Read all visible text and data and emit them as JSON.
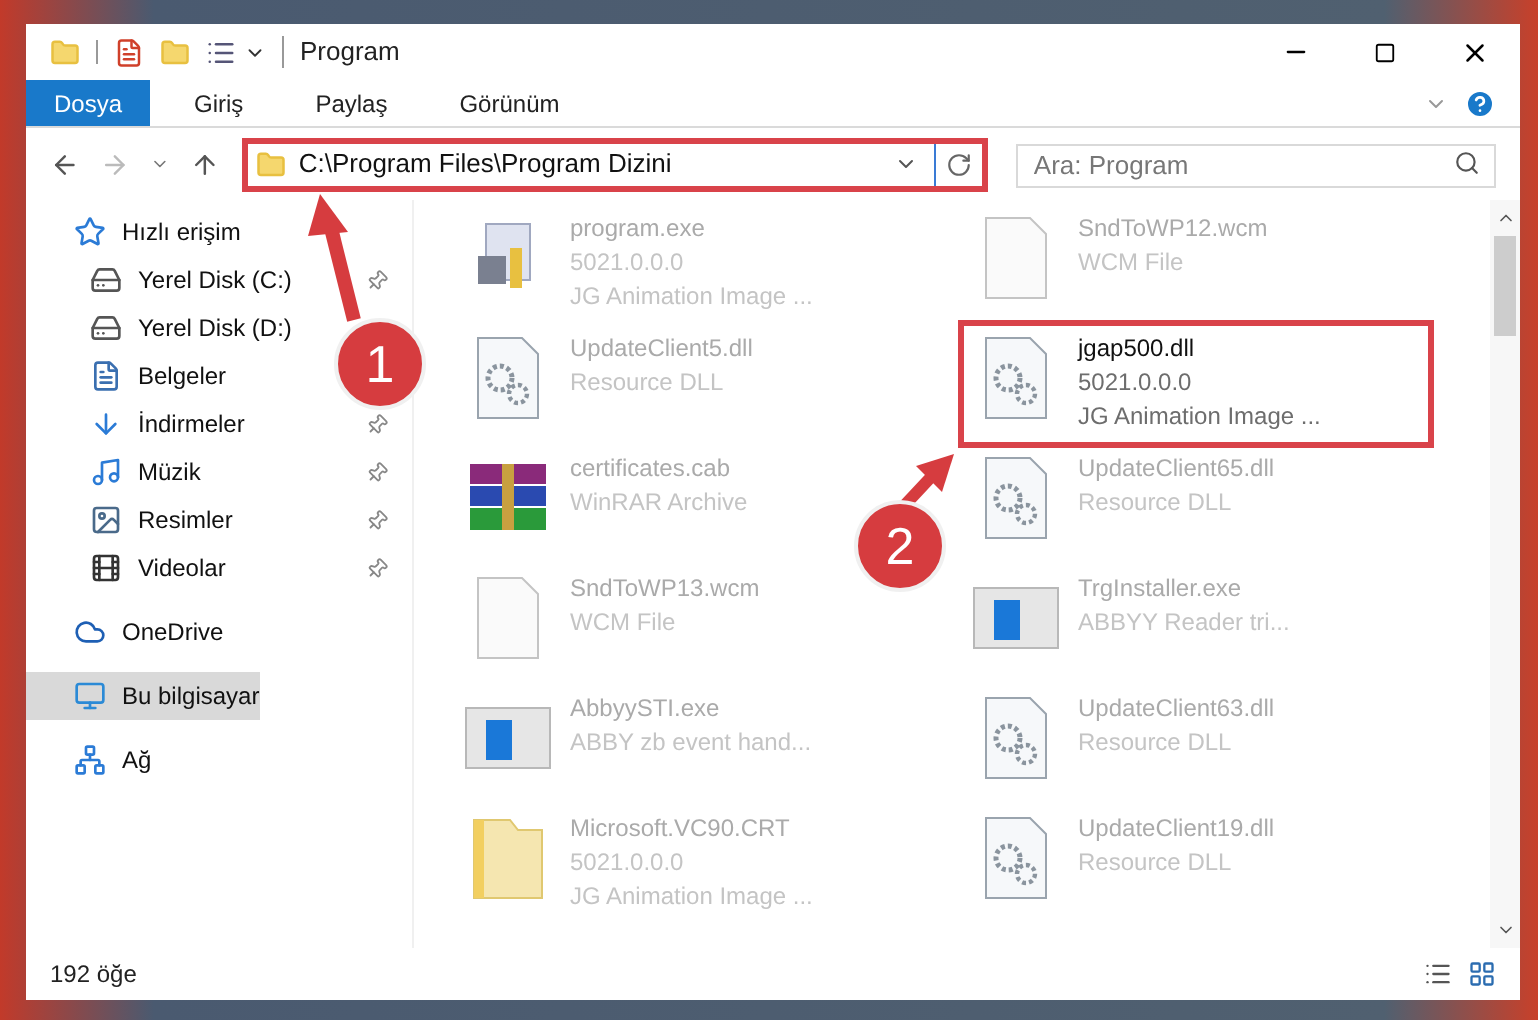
{
  "window": {
    "title": "Program"
  },
  "ribbon_tabs": [
    {
      "label": "Dosya",
      "selected": true
    },
    {
      "label": "Giriş",
      "selected": false
    },
    {
      "label": "Paylaş",
      "selected": false
    },
    {
      "label": "Görünüm",
      "selected": false
    }
  ],
  "address": {
    "path": "C:\\Program Files\\Program Dizini"
  },
  "search": {
    "placeholder": "Ara: Program"
  },
  "sidebar": {
    "items": [
      {
        "label": "Hızlı erişim",
        "kind": "star",
        "selected": false,
        "children": [
          {
            "label": "Yerel Disk (C:)",
            "kind": "drive",
            "pinned": true
          },
          {
            "label": "Yerel Disk (D:)",
            "kind": "drive",
            "pinned": false
          },
          {
            "label": "Belgeler",
            "kind": "document",
            "pinned": false
          },
          {
            "label": "İndirmeler",
            "kind": "download",
            "pinned": true
          },
          {
            "label": "Müzik",
            "kind": "music",
            "pinned": true
          },
          {
            "label": "Resimler",
            "kind": "picture",
            "pinned": true
          },
          {
            "label": "Videolar",
            "kind": "video",
            "pinned": true
          }
        ]
      },
      {
        "label": "OneDrive",
        "kind": "cloud",
        "selected": false
      },
      {
        "label": "Bu bilgisayar",
        "kind": "computer",
        "selected": true
      },
      {
        "label": "Ağ",
        "kind": "network",
        "selected": false
      }
    ]
  },
  "files": [
    {
      "name": "program.exe",
      "details": [
        "5021.0.0.0",
        "JG Animation Image ..."
      ],
      "kind": "exe",
      "highlighted": false
    },
    {
      "name": "SndToWP12.wcm",
      "details": [
        "WCM File"
      ],
      "kind": "blank",
      "highlighted": false
    },
    {
      "name": "UpdateClient5.dll",
      "details": [
        "Resource DLL"
      ],
      "kind": "dll",
      "highlighted": false
    },
    {
      "name": "jgap500.dll",
      "details": [
        "5021.0.0.0",
        "JG Animation Image ..."
      ],
      "kind": "dll",
      "highlighted": true
    },
    {
      "name": "certificates.cab",
      "details": [
        "WinRAR Archive"
      ],
      "kind": "archive",
      "highlighted": false
    },
    {
      "name": "UpdateClient65.dll",
      "details": [
        "Resource DLL"
      ],
      "kind": "dll",
      "highlighted": false
    },
    {
      "name": "SndToWP13.wcm",
      "details": [
        "WCM File"
      ],
      "kind": "blank",
      "highlighted": false
    },
    {
      "name": "TrgInstaller.exe",
      "details": [
        "ABBYY Reader tri..."
      ],
      "kind": "app",
      "highlighted": false
    },
    {
      "name": "AbbyySTI.exe",
      "details": [
        "ABBY zb event hand..."
      ],
      "kind": "app",
      "highlighted": false
    },
    {
      "name": "UpdateClient63.dll",
      "details": [
        "Resource DLL"
      ],
      "kind": "dll",
      "highlighted": false
    },
    {
      "name": "Microsoft.VC90.CRT",
      "details": [
        "5021.0.0.0",
        "JG Animation Image ..."
      ],
      "kind": "folder",
      "highlighted": false
    },
    {
      "name": "UpdateClient19.dll",
      "details": [
        "Resource DLL"
      ],
      "kind": "dll",
      "highlighted": false
    }
  ],
  "status_bar": {
    "count": "192 öğe"
  },
  "annotations": [
    {
      "number": "1"
    },
    {
      "number": "2"
    }
  ]
}
